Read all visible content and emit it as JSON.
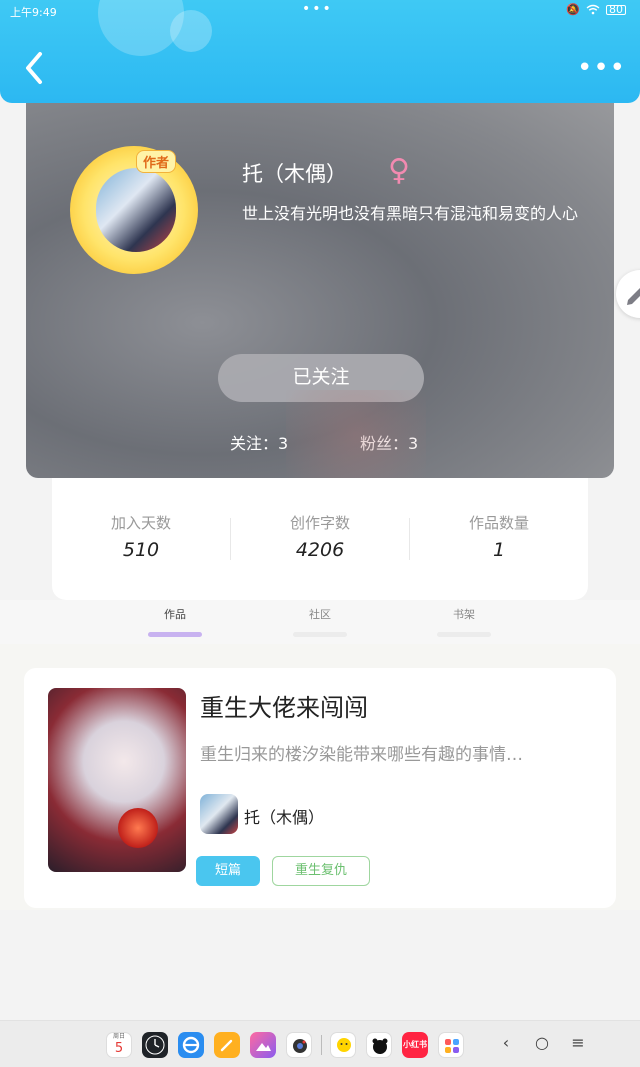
{
  "status_bar": {
    "time": "上午9:49",
    "battery": "80"
  },
  "profile": {
    "author_badge": "作者",
    "name": "托（木偶）",
    "gender_symbol": "♀",
    "bio": "世上没有光明也没有黑暗只有混沌和易变的人心",
    "follow_button": "已关注",
    "following": "关注：3",
    "fans": "粉丝：3"
  },
  "stats": [
    {
      "label": "加入天数",
      "value": "510"
    },
    {
      "label": "创作字数",
      "value": "4206"
    },
    {
      "label": "作品数量",
      "value": "1"
    }
  ],
  "tabs": [
    {
      "label": "作品",
      "active": true
    },
    {
      "label": "社区",
      "active": false
    },
    {
      "label": "书架",
      "active": false
    }
  ],
  "book": {
    "title": "重生大佬来闯闯",
    "description": "重生归来的楼汐染能带来哪些有趣的事情…",
    "author": "托（木偶）",
    "tags": [
      "短篇",
      "重生复仇"
    ]
  },
  "dock": {
    "calendar_weekday": "周日",
    "calendar_day": "5",
    "redbook_label": "小红书"
  },
  "colors": {
    "header": "#2cb8f2",
    "active_tab_indicator": "#c8b2f0",
    "tag_type": "#4ac6ef",
    "tag_genre": "#6cc070"
  }
}
